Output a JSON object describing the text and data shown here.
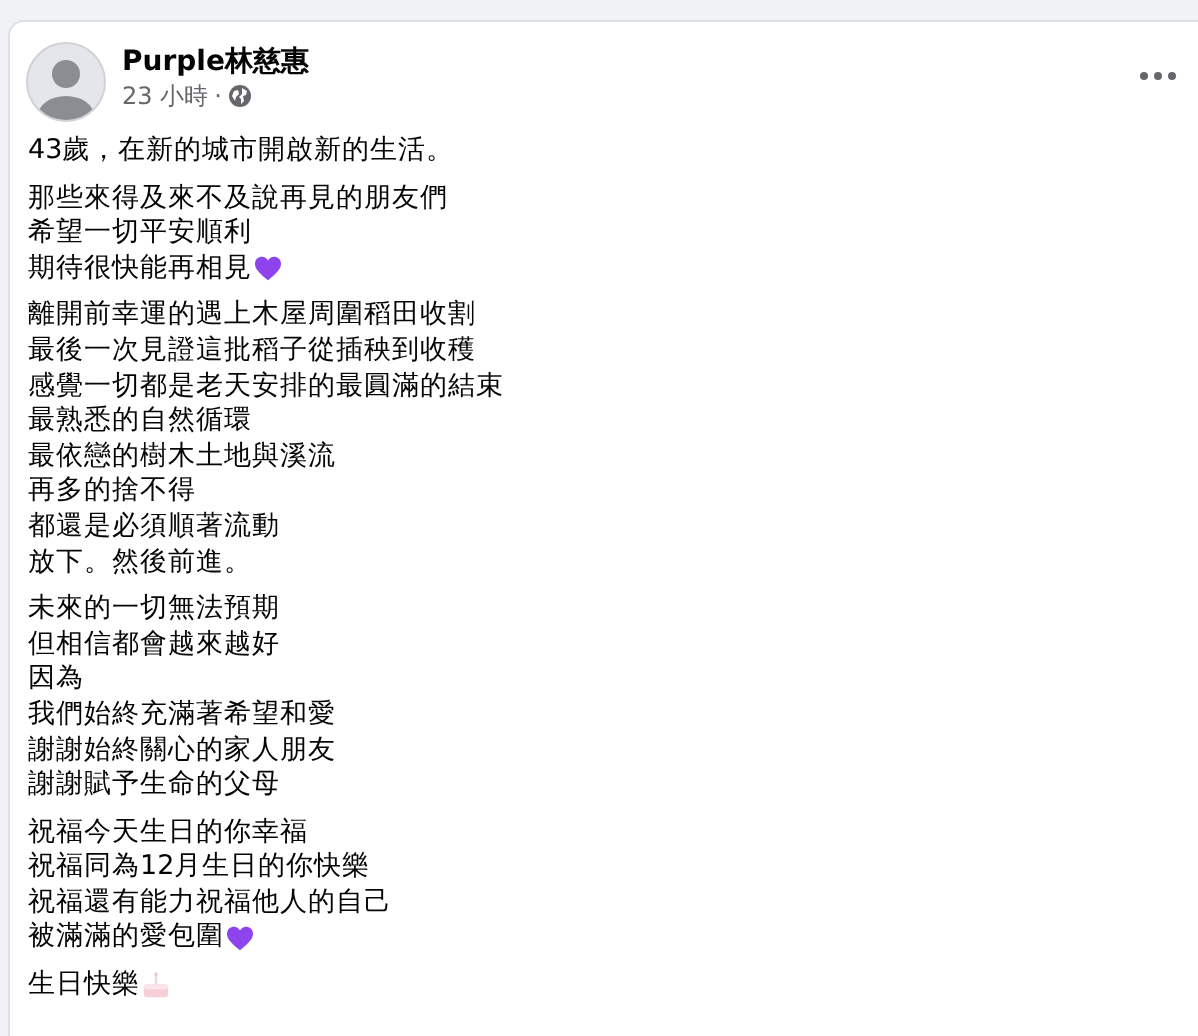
{
  "post": {
    "author": "Purple林慈惠",
    "time": "23 小時",
    "separator": "·",
    "paragraphs": [
      {
        "lines": [
          {
            "text": "43歲，在新的城市開啟新的生活。"
          }
        ]
      },
      {
        "lines": [
          {
            "text": "那些來得及來不及說再見的朋友們"
          },
          {
            "text": "希望一切平安順利"
          },
          {
            "text": "期待很快能再相見",
            "kind": "heart"
          }
        ]
      },
      {
        "lines": [
          {
            "text": "離開前幸運的遇上木屋周圍稻田收割"
          },
          {
            "text": "最後一次見證這批稻子從插秧到收穫"
          },
          {
            "text": "感覺一切都是老天安排的最圓滿的結束"
          },
          {
            "text": "最熟悉的自然循環"
          },
          {
            "text": "最依戀的樹木土地與溪流"
          },
          {
            "text": "再多的捨不得"
          },
          {
            "text": "都還是必須順著流動"
          },
          {
            "text": "放下。然後前進。"
          }
        ]
      },
      {
        "lines": [
          {
            "text": "未來的一切無法預期"
          },
          {
            "text": "但相信都會越來越好"
          },
          {
            "text": "因為"
          },
          {
            "text": "我們始終充滿著希望和愛"
          },
          {
            "text": "謝謝始終關心的家人朋友"
          },
          {
            "text": "謝謝賦予生命的父母"
          }
        ]
      },
      {
        "lines": [
          {
            "text": "祝福今天生日的你幸福"
          },
          {
            "text": "祝福同為12月生日的你快樂"
          },
          {
            "text": "祝福還有能力祝福他人的自己"
          },
          {
            "text": "被滿滿的愛包圍",
            "kind": "heart"
          }
        ]
      },
      {
        "lines": [
          {
            "text": "生日快樂",
            "kind": "cake"
          }
        ]
      }
    ]
  }
}
